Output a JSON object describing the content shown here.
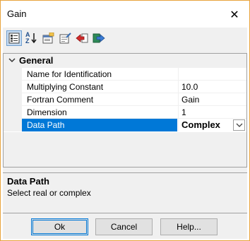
{
  "window": {
    "title": "Gain",
    "close_glyph": "✕"
  },
  "toolbar": {
    "buttons": [
      {
        "name": "categorized-icon",
        "active": true
      },
      {
        "name": "alphabetical-icon",
        "glyph_top": "A",
        "glyph_bottom": "Z"
      },
      {
        "name": "property-pages-icon"
      },
      {
        "name": "edit-page-icon"
      },
      {
        "name": "red-arrow-icon"
      },
      {
        "name": "green-arrow-icon"
      }
    ]
  },
  "grid": {
    "category": {
      "label": "General",
      "expanded": true
    },
    "properties": [
      {
        "name": "Name for Identification",
        "value": ""
      },
      {
        "name": "Multiplying Constant",
        "value": "10.0"
      },
      {
        "name": "Fortran Comment",
        "value": "Gain"
      },
      {
        "name": "Dimension",
        "value": "1"
      },
      {
        "name": "Data Path",
        "value": "Complex",
        "selected": true
      }
    ]
  },
  "description": {
    "title": "Data Path",
    "text": "Select real or complex"
  },
  "buttons": {
    "ok": "Ok",
    "cancel": "Cancel",
    "help": "Help..."
  },
  "colors": {
    "accent": "#0078d7",
    "window_border": "#e8a33d",
    "panel": "#f0f0f0"
  }
}
